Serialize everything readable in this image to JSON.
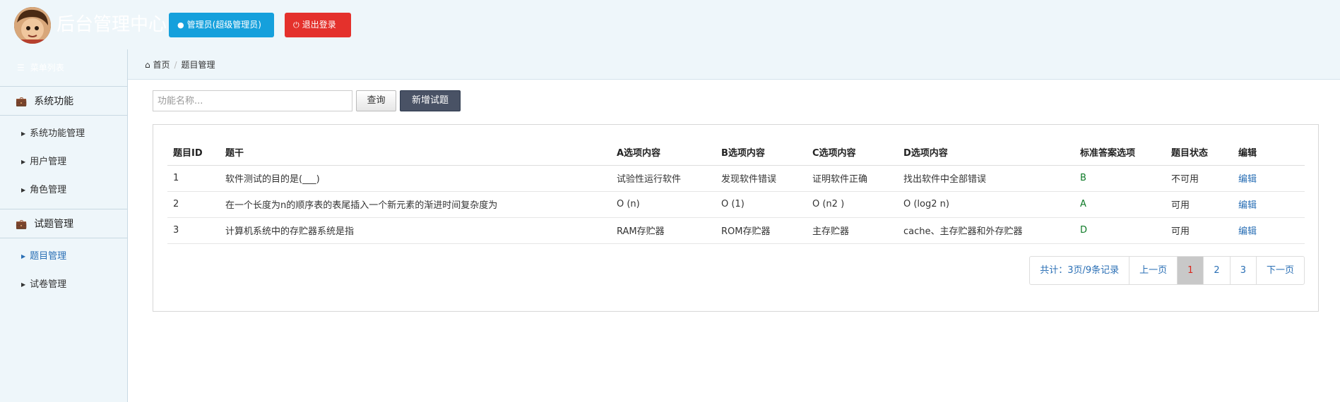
{
  "header": {
    "app_title": "后台管理中心",
    "admin_button": "管理员(超级管理员)",
    "logout_button": "退出登录"
  },
  "sidebar": {
    "heading": "菜单列表",
    "groups": [
      {
        "title": "系统功能",
        "items": [
          {
            "label": "系统功能管理"
          },
          {
            "label": "用户管理"
          },
          {
            "label": "角色管理"
          }
        ]
      },
      {
        "title": "试题管理",
        "items": [
          {
            "label": "题目管理",
            "active": true
          },
          {
            "label": "试卷管理"
          }
        ]
      }
    ]
  },
  "breadcrumb": {
    "home": "首页",
    "current": "题目管理"
  },
  "toolbar": {
    "search_placeholder": "功能名称...",
    "query_button": "查询",
    "add_button": "新增试题"
  },
  "table": {
    "headers": [
      "题目ID",
      "题干",
      "A选项内容",
      "B选项内容",
      "C选项内容",
      "D选项内容",
      "标准答案选项",
      "题目状态",
      "编辑"
    ],
    "rows": [
      [
        "1",
        "软件测试的目的是(___)",
        "试验性运行软件",
        "发现软件错误",
        "证明软件正确",
        "找出软件中全部错误",
        "B",
        "不可用",
        "编辑"
      ],
      [
        "2",
        "在一个长度为n的顺序表的表尾插入一个新元素的渐进时间复杂度为",
        "O (n)",
        "O (1)",
        "O (n2 )",
        "O (log2 n)",
        "A",
        "可用",
        "编辑"
      ],
      [
        "3",
        "计算机系统中的存贮器系统是指",
        "RAM存贮器",
        "ROM存贮器",
        "主存贮器",
        "cache、主存贮器和外存贮器",
        "D",
        "可用",
        "编辑"
      ]
    ]
  },
  "pagination": {
    "info": "共计：3页/9条记录",
    "prev": "上一页",
    "pages": [
      "1",
      "2",
      "3"
    ],
    "current_page": "1",
    "next": "下一页"
  },
  "colors": {
    "admin_button": "#15a0dc",
    "logout_button": "#e4312c",
    "add_button": "#495265",
    "link": "#2a6fb5",
    "answer_text": "#0d7a27",
    "current_page_text": "#d9261c"
  }
}
